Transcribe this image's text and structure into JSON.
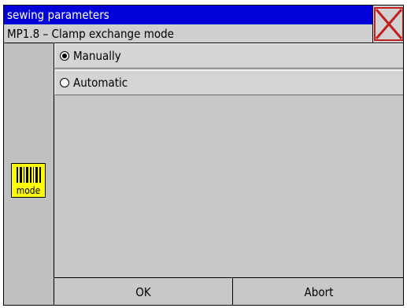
{
  "window": {
    "title": "sewing parameters",
    "subtitle": "MP1.8 – Clamp exchange mode"
  },
  "icons": {
    "close": "close-icon",
    "mode": "barcode-mode-icon"
  },
  "mode_icon": {
    "label": "mode"
  },
  "options": [
    {
      "label": "Manually",
      "selected": true
    },
    {
      "label": "Automatic",
      "selected": false
    }
  ],
  "buttons": {
    "ok_label": "OK",
    "abort_label": "Abort"
  },
  "colors": {
    "title_bg": "#0000d8",
    "close_x": "#c02020",
    "mode_icon_bg": "#ffff00",
    "panel_bg": "#c8c8c8"
  }
}
